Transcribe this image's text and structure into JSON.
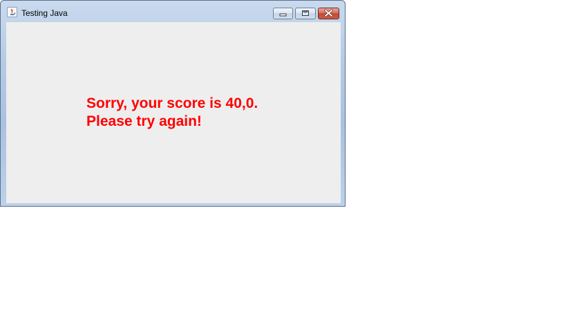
{
  "window": {
    "title": "Testing Java",
    "icon": "java-icon",
    "controls": {
      "minimize_icon": "minimize-icon",
      "maximize_icon": "maximize-icon",
      "close_icon": "close-icon"
    }
  },
  "message": {
    "line1": "Sorry, your score is 40,0.",
    "line2": "Please try again!",
    "color": "#ff0000"
  }
}
